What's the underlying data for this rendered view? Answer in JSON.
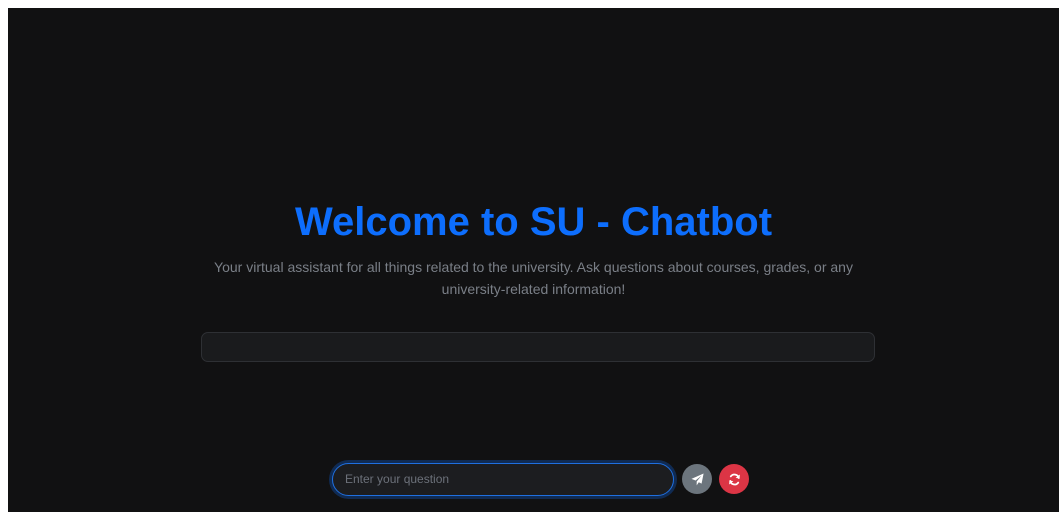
{
  "hero": {
    "title": "Welcome to SU - Chatbot",
    "subtitle": "Your virtual assistant for all things related to the university. Ask questions about courses, grades, or any university-related information!"
  },
  "chat": {
    "messages": []
  },
  "composer": {
    "value": "",
    "placeholder": "Enter your question",
    "send_icon": "paper-plane-icon",
    "refresh_icon": "refresh-icon"
  },
  "colors": {
    "background": "#111112",
    "accent": "#0d6efd",
    "send_button": "#6c757d",
    "refresh_button": "#dc3545"
  }
}
